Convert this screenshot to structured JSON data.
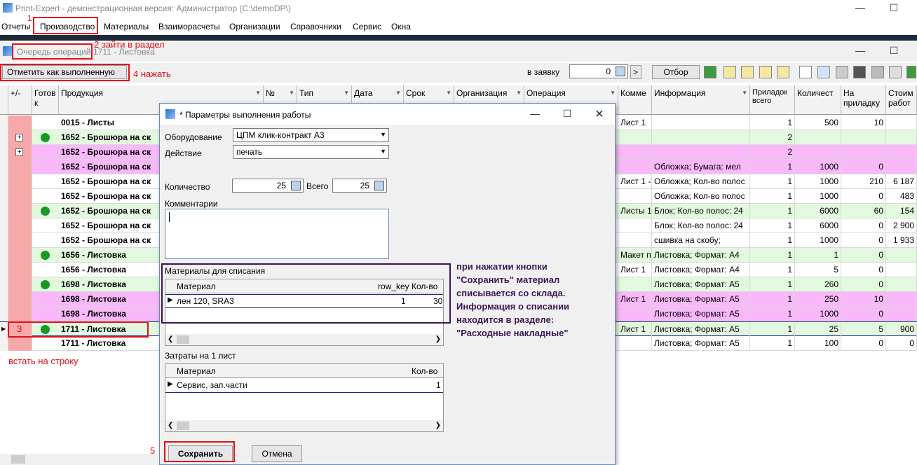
{
  "window": {
    "title": "Print-Expert - демонстрационная версия: Администратор (C:\\demoDP\\)"
  },
  "menu": [
    "Отчеты",
    "Производство",
    "Материалы",
    "Взаиморасчеты",
    "Организации",
    "Справочники",
    "Сервис",
    "Окна"
  ],
  "subwindow": {
    "title_prefix": "Очередь операций:",
    "title_suffix": "1711 - Листовка"
  },
  "toolbar": {
    "mark_done": "Отметить как выполненную",
    "to_order_label": "в заявку",
    "to_order_value": "0",
    "next": ">",
    "filter": "Отбор"
  },
  "grid": {
    "headers": [
      "+/-",
      "Готов к",
      "Продукция",
      "№",
      "Тип",
      "Дата",
      "Срок",
      "Организация",
      "Операция",
      "Комме",
      "Информация",
      "Приладок всего",
      "Количест",
      "На приладку",
      "Стоим работ"
    ],
    "rows": [
      {
        "prod": "0015 - Листы",
        "comment": "Лист 1",
        "info": "",
        "pril": "1",
        "qty": "500",
        "na": "10",
        "cost": "",
        "bg": "#ffffff",
        "pink": false,
        "dot": false,
        "plus": false
      },
      {
        "prod": "1652 - Брошюра на ск",
        "comment": "",
        "info": "",
        "pril": "2",
        "qty": "",
        "na": "",
        "cost": "",
        "bg": "#e3f9df",
        "pink": false,
        "dot": true,
        "plus": true
      },
      {
        "prod": "1652 - Брошюра на ск",
        "comment": "",
        "info": "",
        "pril": "2",
        "qty": "",
        "na": "",
        "cost": "",
        "bg": "#f9b8f9",
        "pink": false,
        "dot": false,
        "plus": true
      },
      {
        "prod": "1652 - Брошюра на ск",
        "comment": "",
        "info": "Обложка; Бумага: мел",
        "pril": "1",
        "qty": "1000",
        "na": "0",
        "cost": "",
        "bg": "#f9b8f9",
        "pink": false,
        "dot": false,
        "plus": false
      },
      {
        "prod": "1652 - Брошюра на ск",
        "comment": "Лист 1 -",
        "info": "Обложка; Кол-во полос",
        "pril": "1",
        "qty": "1000",
        "na": "210",
        "cost": "6 187",
        "bg": "#ffffff",
        "pink": false,
        "dot": false,
        "plus": false
      },
      {
        "prod": "1652 - Брошюра на ск",
        "comment": "",
        "info": "Обложка; Кол-во полос",
        "pril": "1",
        "qty": "1000",
        "na": "0",
        "cost": "483",
        "bg": "#ffffff",
        "pink": false,
        "dot": false,
        "plus": false
      },
      {
        "prod": "1652 - Брошюра на ск",
        "comment": "Листы 1",
        "info": "Блок; Кол-во полос: 24",
        "pril": "1",
        "qty": "6000",
        "na": "60",
        "cost": "154",
        "bg": "#e3f9df",
        "pink": false,
        "dot": true,
        "plus": false
      },
      {
        "prod": "1652 - Брошюра на ск",
        "comment": "",
        "info": "Блок; Кол-во полос: 24",
        "pril": "1",
        "qty": "6000",
        "na": "0",
        "cost": "2 900",
        "bg": "#ffffff",
        "pink": false,
        "dot": false,
        "plus": false
      },
      {
        "prod": "1652 - Брошюра на ск",
        "comment": "",
        "info": "сшивка на скобу;",
        "pril": "1",
        "qty": "1000",
        "na": "0",
        "cost": "1 933",
        "bg": "#ffffff",
        "pink": false,
        "dot": false,
        "plus": false
      },
      {
        "prod": "1656 - Листовка",
        "comment": "Макет п",
        "info": "Листовка; Формат: А4",
        "pril": "1",
        "qty": "1",
        "na": "0",
        "cost": "",
        "bg": "#e3f9df",
        "pink": false,
        "dot": true,
        "plus": false
      },
      {
        "prod": "1656 - Листовка",
        "comment": "Лист 1",
        "info": "Листовка; Формат: А4",
        "pril": "1",
        "qty": "5",
        "na": "0",
        "cost": "",
        "bg": "#ffffff",
        "pink": false,
        "dot": false,
        "plus": false
      },
      {
        "prod": "1698 - Листовка",
        "comment": "",
        "info": "Листовка; Формат: А5",
        "pril": "1",
        "qty": "260",
        "na": "0",
        "cost": "",
        "bg": "#e3f9df",
        "pink": false,
        "dot": true,
        "plus": false
      },
      {
        "prod": "1698 - Листовка",
        "comment": "Лист 1",
        "info": "Листовка; Формат: А5",
        "pril": "1",
        "qty": "250",
        "na": "10",
        "cost": "",
        "bg": "#f9b8f9",
        "pink": false,
        "dot": false,
        "plus": false
      },
      {
        "prod": "1698 - Листовка",
        "comment": "",
        "info": "Листовка; Формат: А5",
        "pril": "1",
        "qty": "1000",
        "na": "0",
        "cost": "",
        "bg": "#f9b8f9",
        "pink": false,
        "dot": false,
        "plus": false
      },
      {
        "prod": "1711 - Листовка",
        "comment": "Лист 1",
        "info": "Листовка; Формат: А5",
        "pril": "1",
        "qty": "25",
        "na": "5",
        "cost": "900",
        "bg": "#e3f9df",
        "pink": false,
        "dot": true,
        "plus": false
      },
      {
        "prod": "1711 - Листовка",
        "comment": "",
        "info": "Листовка; Формат: А5",
        "pril": "1",
        "qty": "100",
        "na": "0",
        "cost": "0",
        "bg": "#ffffff",
        "pink": false,
        "dot": false,
        "plus": false
      }
    ]
  },
  "dialog": {
    "title": "* Параметры выполнения работы",
    "equipment_label": "Оборудование",
    "equipment_value": "ЦПМ клик-контракт А3",
    "action_label": "Действие",
    "action_value": "печать",
    "qty_label": "Количество",
    "qty_value": "25",
    "total_label": "Всего",
    "total_value": "25",
    "comments_label": "Комментарии",
    "materials_label": "Материалы для списания",
    "materials_headers": [
      "Материал",
      "row_key",
      "Кол-во"
    ],
    "materials_row": [
      "лен 120, SRA3",
      "1",
      "30"
    ],
    "costs_label": "Затраты на 1 лист",
    "costs_headers": [
      "Материал",
      "Кол-во"
    ],
    "costs_row": [
      "Сервис, зап.части",
      "1"
    ],
    "save": "Сохранить",
    "cancel": "Отмена"
  },
  "annotations": {
    "n1": "1",
    "n2": "2 зайти в раздел",
    "n3": "3",
    "n3_text": "встать на строку",
    "n4": "4 нажать",
    "n5": "5",
    "note": [
      "при нажатии кнопки",
      "\"Сохранить\" материал",
      "списывается со склада.",
      "Информация о списании",
      "находится в разделе:",
      "\"Расходные накладные\""
    ]
  }
}
